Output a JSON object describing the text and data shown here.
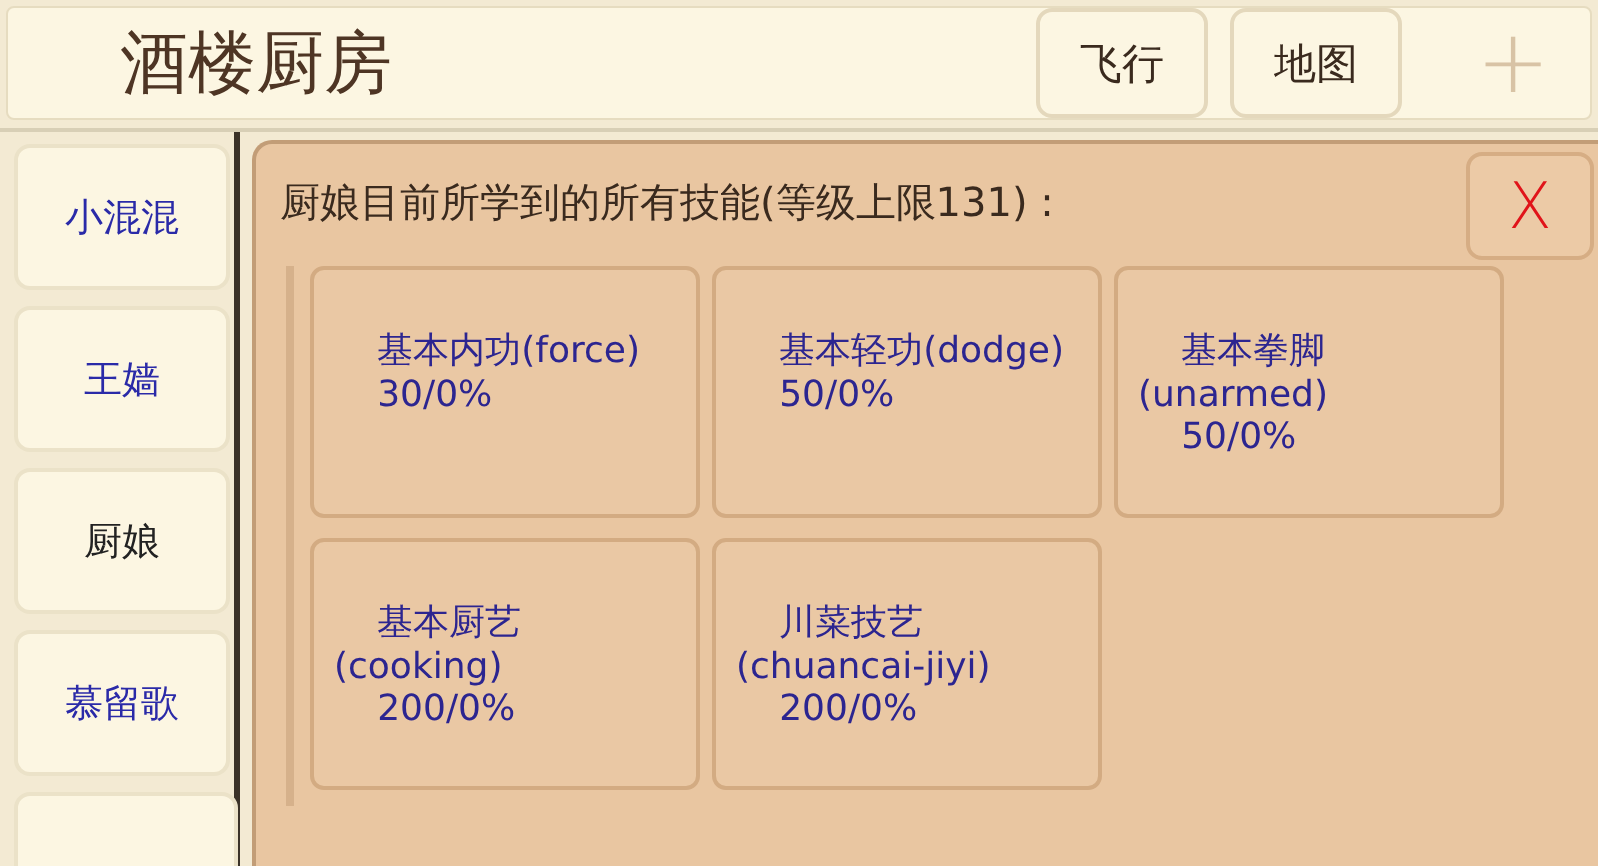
{
  "header": {
    "title": "酒楼厨房",
    "buttons": [
      "飞行",
      "地图"
    ],
    "add_symbol": "+"
  },
  "sidebar": {
    "items": [
      {
        "label": "小混混",
        "selected": false
      },
      {
        "label": "王嫱",
        "selected": false
      },
      {
        "label": "厨娘",
        "selected": true
      },
      {
        "label": "慕留歌",
        "selected": false
      }
    ]
  },
  "panel": {
    "heading": "厨娘目前所学到的所有技能(等级上限131) :",
    "close_symbol": "X",
    "skills": [
      {
        "name": "基本内功(force)",
        "level_text": "30/0%"
      },
      {
        "name": "基本轻功(dodge)",
        "level_text": "50/0%"
      },
      {
        "name": "基本拳脚(unarmed)",
        "level_text": "50/0%"
      },
      {
        "name": "基本厨艺(cooking)",
        "level_text": "200/0%"
      },
      {
        "name": "川菜技艺(chuancai-jiyi)",
        "level_text": "200/0%"
      }
    ]
  }
}
